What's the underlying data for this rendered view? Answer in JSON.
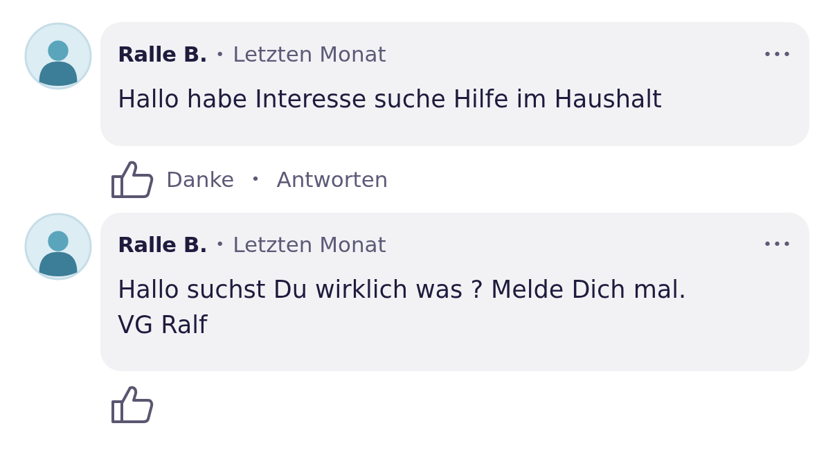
{
  "comments": [
    {
      "author": "Ralle B.",
      "separator": "•",
      "time": "Letzten Monat",
      "menu": "•••",
      "text": "Hallo habe Interesse suche Hilfe im Haushalt",
      "like": "Danke",
      "dot": "•",
      "reply": "Antworten"
    },
    {
      "author": "Ralle B.",
      "separator": "•",
      "time": "Letzten Monat",
      "menu": "•••",
      "text": "Hallo suchst Du wirklich was ? Melde Dich mal.\nVG Ralf"
    }
  ]
}
